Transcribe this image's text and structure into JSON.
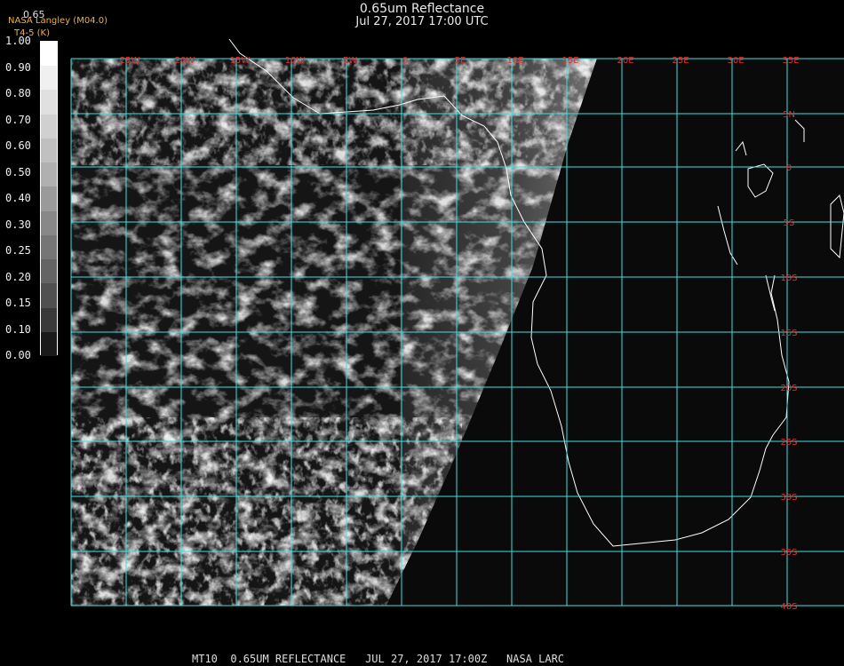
{
  "header": {
    "title": "0.65um Reflectance",
    "subtitle": "Jul 27, 2017 17:00 UTC"
  },
  "corner": {
    "value": "0.65",
    "org": "NASA Langley (M04.0)",
    "channel": "T4-5 (K)"
  },
  "colorbar": {
    "ticks": [
      "1.00",
      "0.90",
      "0.80",
      "0.70",
      "0.60",
      "0.50",
      "0.40",
      "0.30",
      "0.25",
      "0.20",
      "0.15",
      "0.10",
      "0.00"
    ],
    "colors": [
      "#ffffff",
      "#f0f0f0",
      "#e0e0e0",
      "#d0d0d0",
      "#c0c0c0",
      "#b0b0b0",
      "#9a9a9a",
      "#888888",
      "#767676",
      "#646464",
      "#505050",
      "#3a3a3a",
      "#1a1a1a"
    ]
  },
  "map": {
    "grid_color": "#40e0e0",
    "label_color": "#e03030",
    "lon_labels": [
      "25W",
      "20W",
      "15W",
      "10W",
      "5W",
      "0",
      "5E",
      "10E",
      "15E",
      "20E",
      "25E",
      "30E",
      "35E"
    ],
    "lat_labels": [
      "5N",
      "0",
      "5S",
      "10S",
      "15S",
      "20S",
      "25S",
      "30S",
      "35S",
      "40S"
    ],
    "land_color": "#0d0d0d",
    "coast_color": "#ffffff"
  },
  "footer": {
    "text": "MT10  0.65UM REFLECTANCE   JUL 27, 2017 17:00Z   NASA LARC"
  }
}
